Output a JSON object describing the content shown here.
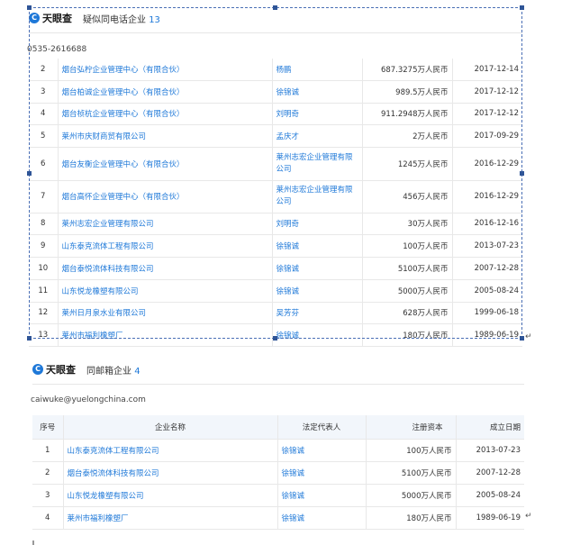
{
  "section1": {
    "brand": "天眼查",
    "title": "疑似同电话企业",
    "count": "13",
    "phone": "0535-2616688",
    "rows": [
      {
        "idx": "2",
        "name": "烟台弘柠企业管理中心（有限合伙）",
        "rep": "杨鹏",
        "capital": "687.3275万人民币",
        "date": "2017-12-14"
      },
      {
        "idx": "3",
        "name": "烟台柏诚企业管理中心（有限合伙）",
        "rep": "徐锦诚",
        "capital": "989.5万人民币",
        "date": "2017-12-12"
      },
      {
        "idx": "4",
        "name": "烟台桢杭企业管理中心（有限合伙）",
        "rep": "刘明奇",
        "capital": "911.2948万人民币",
        "date": "2017-12-12"
      },
      {
        "idx": "5",
        "name": "莱州市庆财商贸有限公司",
        "rep": "孟庆才",
        "capital": "2万人民币",
        "date": "2017-09-29"
      },
      {
        "idx": "6",
        "name": "烟台友衡企业管理中心（有限合伙）",
        "rep": "莱州志宏企业管理有限公司",
        "capital": "1245万人民币",
        "date": "2016-12-29"
      },
      {
        "idx": "7",
        "name": "烟台高怀企业管理中心（有限合伙）",
        "rep": "莱州志宏企业管理有限公司",
        "capital": "456万人民币",
        "date": "2016-12-29"
      },
      {
        "idx": "8",
        "name": "莱州志宏企业管理有限公司",
        "rep": "刘明奇",
        "capital": "30万人民币",
        "date": "2016-12-16"
      },
      {
        "idx": "9",
        "name": "山东泰克流体工程有限公司",
        "rep": "徐锦诚",
        "capital": "100万人民币",
        "date": "2013-07-23"
      },
      {
        "idx": "10",
        "name": "烟台泰悦流体科技有限公司",
        "rep": "徐锦诚",
        "capital": "5100万人民币",
        "date": "2007-12-28"
      },
      {
        "idx": "11",
        "name": "山东悦龙橡塑有限公司",
        "rep": "徐锦诚",
        "capital": "5000万人民币",
        "date": "2005-08-24"
      },
      {
        "idx": "12",
        "name": "莱州日月泉水业有限公司",
        "rep": "吴芳芬",
        "capital": "628万人民币",
        "date": "1999-06-18"
      },
      {
        "idx": "13",
        "name": "莱州市福利橡塑厂",
        "rep": "徐锦诚",
        "capital": "180万人民币",
        "date": "1989-06-19"
      }
    ]
  },
  "section2": {
    "brand": "天眼查",
    "title": "同邮箱企业",
    "count": "4",
    "email": "caiwuke@yuelongchina.com",
    "headers": {
      "idx": "序号",
      "name": "企业名称",
      "rep": "法定代表人",
      "capital": "注册资本",
      "date": "成立日期"
    },
    "rows": [
      {
        "idx": "1",
        "name": "山东泰克流体工程有限公司",
        "rep": "徐锦诚",
        "capital": "100万人民币",
        "date": "2013-07-23"
      },
      {
        "idx": "2",
        "name": "烟台泰悦流体科技有限公司",
        "rep": "徐锦诚",
        "capital": "5100万人民币",
        "date": "2007-12-28"
      },
      {
        "idx": "3",
        "name": "山东悦龙橡塑有限公司",
        "rep": "徐锦诚",
        "capital": "5000万人民币",
        "date": "2005-08-24"
      },
      {
        "idx": "4",
        "name": "莱州市福利橡塑厂",
        "rep": "徐锦诚",
        "capital": "180万人民币",
        "date": "1989-06-19"
      }
    ]
  },
  "marks": {
    "return": "↵"
  },
  "colors": {
    "link": "#1e78d8",
    "header_bg": "#f2f6fb",
    "selection": "#2f5597"
  }
}
